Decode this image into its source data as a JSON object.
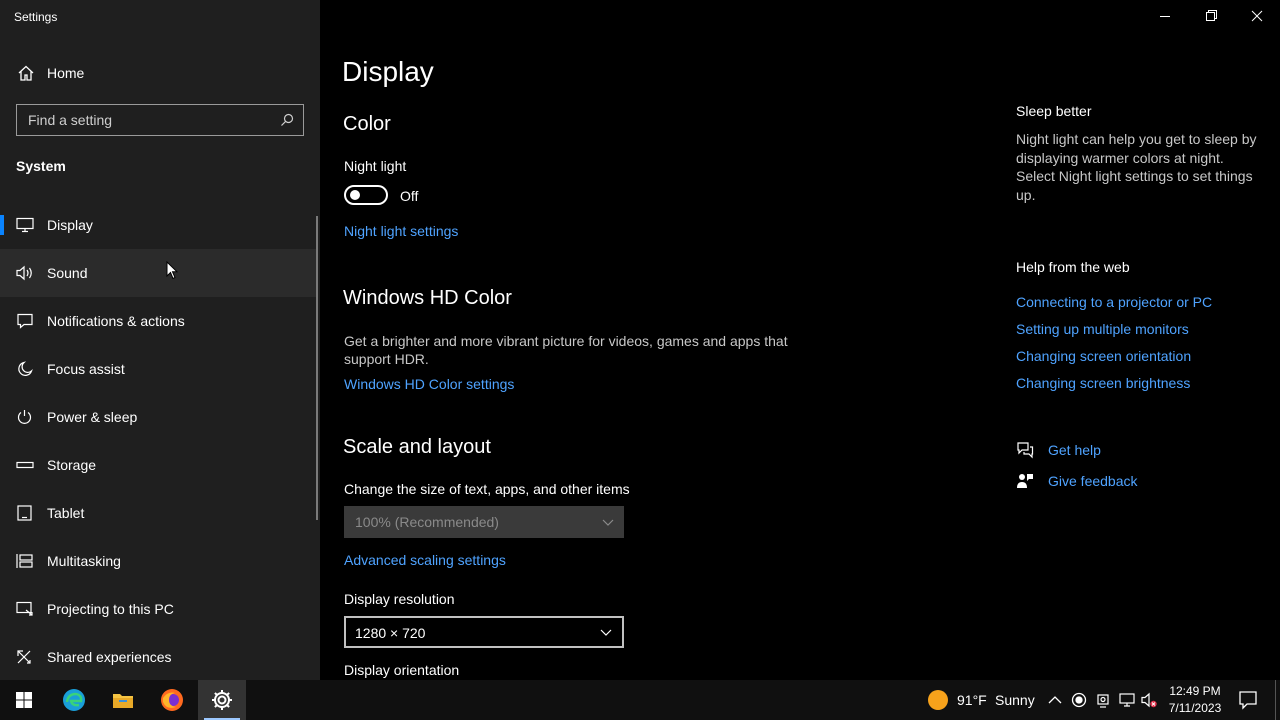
{
  "window": {
    "app_title": "Settings"
  },
  "sidebar": {
    "home_label": "Home",
    "search_placeholder": "Find a setting",
    "section_title": "System",
    "items": [
      {
        "label": "Display",
        "icon": "monitor-icon"
      },
      {
        "label": "Sound",
        "icon": "speaker-icon"
      },
      {
        "label": "Notifications & actions",
        "icon": "notification-icon"
      },
      {
        "label": "Focus assist",
        "icon": "moon-icon"
      },
      {
        "label": "Power & sleep",
        "icon": "power-icon"
      },
      {
        "label": "Storage",
        "icon": "storage-icon"
      },
      {
        "label": "Tablet",
        "icon": "tablet-icon"
      },
      {
        "label": "Multitasking",
        "icon": "multitasking-icon"
      },
      {
        "label": "Projecting to this PC",
        "icon": "projecting-icon"
      },
      {
        "label": "Shared experiences",
        "icon": "shared-experiences-icon"
      }
    ],
    "selected": "Display",
    "hovered": "Sound"
  },
  "main": {
    "page_title": "Display",
    "color": {
      "heading": "Color",
      "night_light_label": "Night light",
      "night_light_state": "Off",
      "night_light_settings_link": "Night light settings"
    },
    "hd_color": {
      "heading": "Windows HD Color",
      "description_line1": "Get a brighter and more vibrant picture for videos, games and apps that",
      "description_line2": "support HDR.",
      "settings_link": "Windows HD Color settings"
    },
    "scale_layout": {
      "heading": "Scale and layout",
      "size_label": "Change the size of text, apps, and other items",
      "size_value": "100% (Recommended)",
      "advanced_link": "Advanced scaling settings",
      "resolution_label": "Display resolution",
      "resolution_value": "1280 × 720",
      "orientation_label": "Display orientation"
    }
  },
  "right_panel": {
    "sleep_heading": "Sleep better",
    "sleep_text": "Night light can help you get to sleep by displaying warmer colors at night. Select Night light settings to set things up.",
    "help_heading": "Help from the web",
    "help_links": [
      "Connecting to a projector or PC",
      "Setting up multiple monitors",
      "Changing screen orientation",
      "Changing screen brightness"
    ],
    "get_help": "Get help",
    "give_feedback": "Give feedback"
  },
  "taskbar": {
    "weather_temp": "91°F",
    "weather_desc": "Sunny",
    "time": "12:49 PM",
    "date": "7/11/2023",
    "pinned": [
      "windows-start-icon",
      "edge-icon",
      "file-explorer-icon",
      "firefox-icon",
      "settings-icon"
    ]
  },
  "colors": {
    "accent": "#0a84ff",
    "link": "#4fa3ff",
    "sidebar_bg": "#1f1f1f",
    "main_bg": "#000000"
  }
}
